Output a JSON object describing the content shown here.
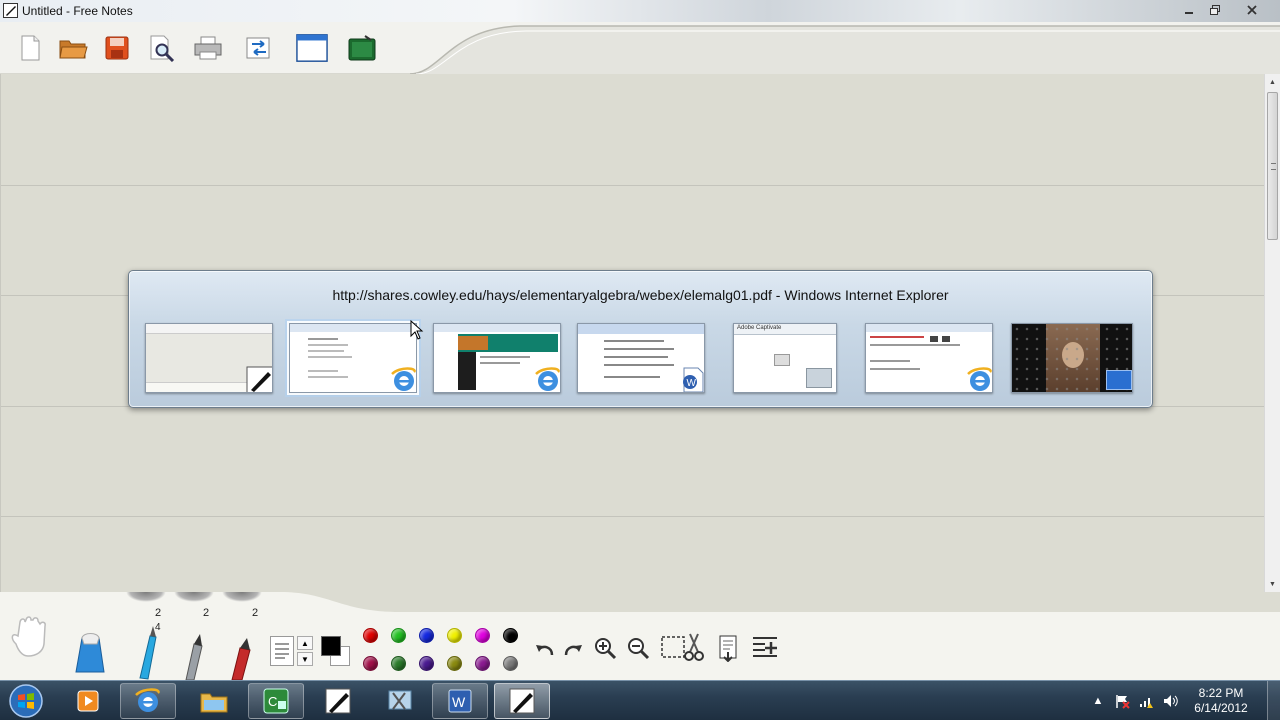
{
  "window": {
    "title": "Untitled - Free Notes",
    "controls": [
      "minimize",
      "restore",
      "close"
    ]
  },
  "toolbar": {
    "buttons": [
      {
        "name": "new-document-icon"
      },
      {
        "name": "open-folder-icon"
      },
      {
        "name": "save-icon"
      },
      {
        "name": "print-preview-icon"
      },
      {
        "name": "print-icon"
      },
      {
        "name": "import-export-icon"
      },
      {
        "name": "window-view-icon"
      },
      {
        "name": "slate-board-icon"
      }
    ]
  },
  "switcher": {
    "title": "http://shares.cowley.edu/hays/elementaryalgebra/webex/elemalg01.pdf - Windows Internet Explorer",
    "thumbnails": [
      {
        "name": "thumb-free-notes",
        "app": "free-notes",
        "selected": false
      },
      {
        "name": "thumb-ie-elemalg01-pdf",
        "app": "internet-explorer",
        "selected": true
      },
      {
        "name": "thumb-ie-website",
        "app": "internet-explorer",
        "selected": false
      },
      {
        "name": "thumb-word-document",
        "app": "word",
        "selected": false
      },
      {
        "name": "thumb-adobe-captivate",
        "app": "captivate",
        "selected": false,
        "caption": "Adobe Captivate"
      },
      {
        "name": "thumb-ie-second",
        "app": "internet-explorer",
        "selected": false
      },
      {
        "name": "thumb-desktop",
        "app": "desktop",
        "selected": false
      }
    ]
  },
  "bottom_panel": {
    "tab_numbers": [
      "2",
      "2",
      "2"
    ],
    "pen_width_value": "4",
    "colors_top": [
      "#e00000",
      "#22c022",
      "#1428e0",
      "#f0f000",
      "#e000e0",
      "#000000"
    ],
    "colors_bottom": [
      "#a01048",
      "#2a7a2a",
      "#4a1a90",
      "#8a8a10",
      "#8a1a90",
      "#7a7a7a"
    ],
    "current_color": "#000000"
  },
  "taskbar": {
    "apps": [
      {
        "name": "media-player-icon",
        "state": "pinned"
      },
      {
        "name": "internet-explorer-icon",
        "state": "open"
      },
      {
        "name": "windows-explorer-icon",
        "state": "pinned"
      },
      {
        "name": "camtasia-icon",
        "state": "open"
      },
      {
        "name": "free-notes-icon",
        "state": "pinned"
      },
      {
        "name": "snipping-tool-icon",
        "state": "pinned"
      },
      {
        "name": "word-icon",
        "state": "open"
      },
      {
        "name": "free-notes-active-icon",
        "state": "active"
      }
    ],
    "clock_time": "8:22 PM",
    "clock_date": "6/14/2012"
  }
}
